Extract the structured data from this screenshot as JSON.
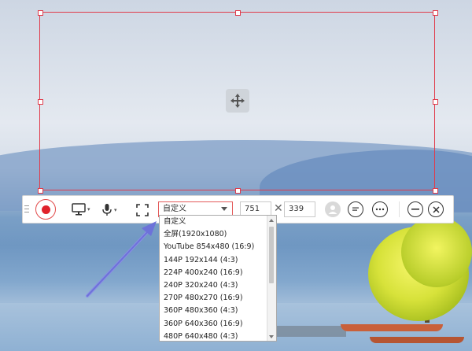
{
  "toolbar": {
    "size_preset": "自定义",
    "width": "751",
    "times": "✕",
    "height": "339"
  },
  "dropdown": {
    "options": [
      "自定义",
      "全屏(1920x1080)",
      "YouTube 854x480 (16:9)",
      "144P 192x144 (4:3)",
      "224P 400x240 (16:9)",
      "240P 320x240 (4:3)",
      "270P 480x270 (16:9)",
      "360P 480x360 (4:3)",
      "360P 640x360 (16:9)",
      "480P 640x480 (4:3)"
    ]
  },
  "icons": {
    "move": "move-arrows-icon",
    "record": "record-icon",
    "screen": "monitor-icon",
    "mic": "microphone-icon",
    "fullscreen": "fullscreen-icon",
    "avatar": "webcam-icon",
    "comment": "comment-icon",
    "more": "more-icon",
    "minimize": "minimize-icon",
    "close": "close-icon"
  },
  "colors": {
    "accent": "#e03a4a",
    "record": "#e0222b",
    "annotation_arrow": "#7b7fe0"
  }
}
